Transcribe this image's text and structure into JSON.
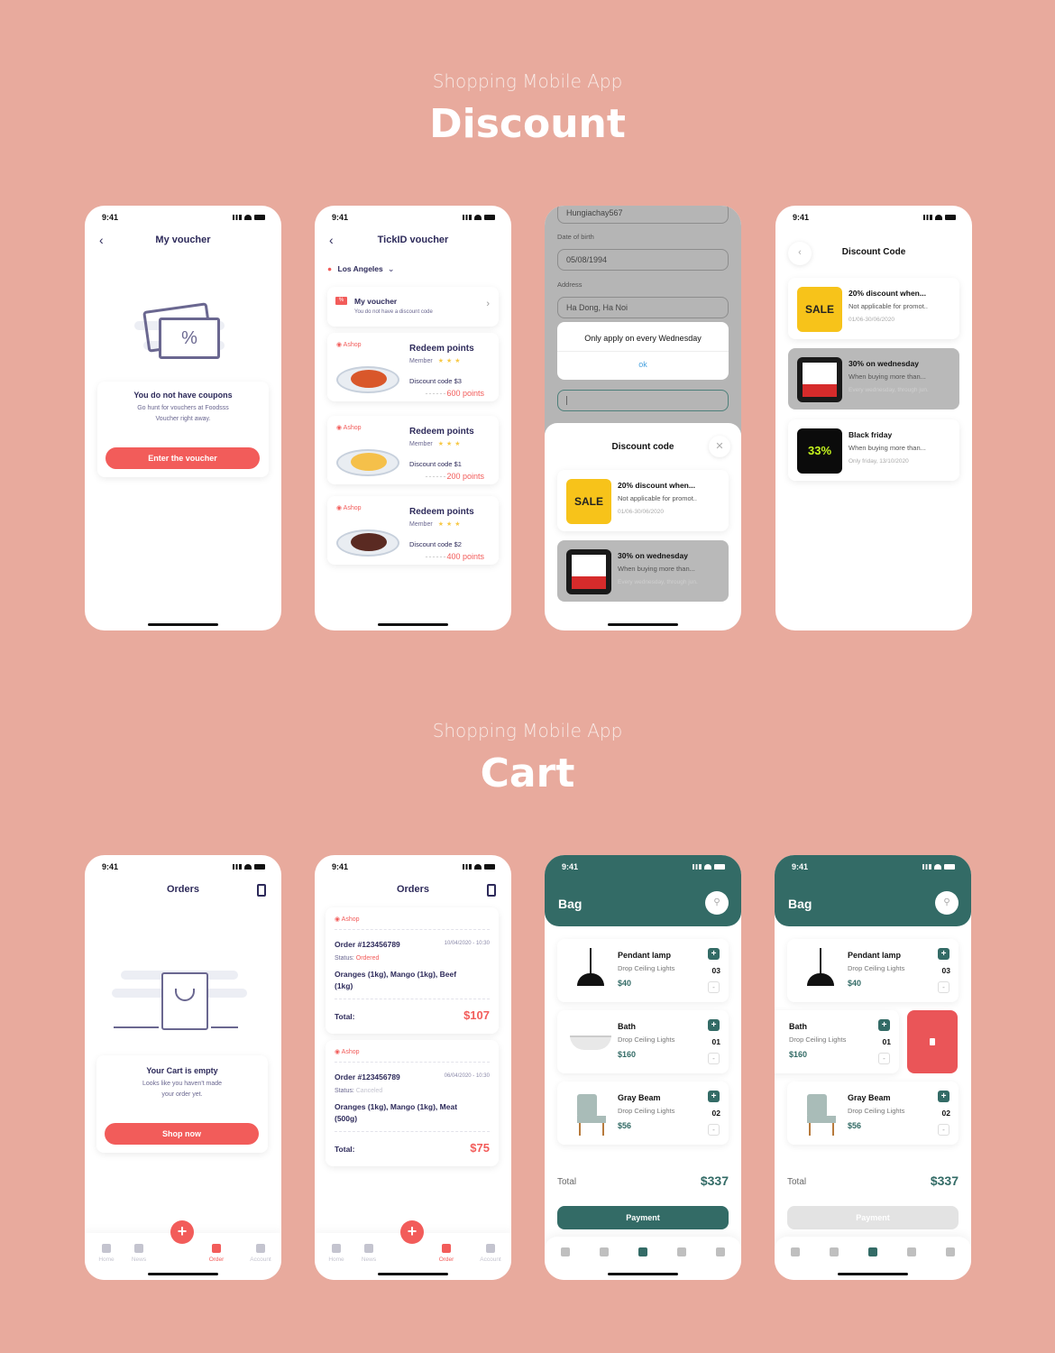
{
  "sections": [
    {
      "subtitle": "Shopping Mobile App",
      "title": "Discount"
    },
    {
      "subtitle": "Shopping Mobile App",
      "title": "Cart"
    }
  ],
  "status_time": "9:41",
  "my_voucher": {
    "title": "My voucher",
    "empty_title": "You do not have coupons",
    "empty_sub_1": "Go hunt for vouchers at Foodsss",
    "empty_sub_2": "Voucher right away.",
    "button": "Enter the voucher",
    "illustration_symbol": "%"
  },
  "tickid": {
    "title": "TickID voucher",
    "location": "Los Angeles",
    "my_voucher_label": "My voucher",
    "my_voucher_sub": "You do not have a discount code",
    "offers": [
      {
        "shop": "Ashop",
        "title": "Redeem points",
        "member": "Member",
        "stars": 3,
        "code": "Discount code $3",
        "points": "600 points",
        "food_color": "#d9572a"
      },
      {
        "shop": "Ashop",
        "title": "Redeem points",
        "member": "Member",
        "stars": 3,
        "code": "Discount code $1",
        "points": "200 points",
        "food_color": "#f5c04a"
      },
      {
        "shop": "Ashop",
        "title": "Redeem points",
        "member": "Member",
        "stars": 3,
        "code": "Discount code $2",
        "points": "400 points",
        "food_color": "#5a2a22"
      }
    ]
  },
  "profile_dialog": {
    "username_value": "Hungiachay567",
    "dob_label": "Date of birth",
    "dob_value": "05/08/1994",
    "address_label": "Address",
    "address_value": "Ha Dong, Ha Noi",
    "alert_message": "Only apply on every Wednesday",
    "alert_ok": "ok",
    "sheet_title": "Discount code"
  },
  "discount_codes": [
    {
      "title": "20% discount when...",
      "sub": "Not applicable for promot..",
      "date": "01/06-30/06/2020",
      "thumb_text": "SALE",
      "thumb_color": "#f7c31a",
      "selected": false
    },
    {
      "title": "30% on wednesday",
      "sub": "When buying more than...",
      "date": "Every wednesday, through jun.",
      "thumb_text": "",
      "thumb_color": "#1a1a1a",
      "selected": true
    },
    {
      "title": "Black friday",
      "sub": "When buying more than...",
      "date": "Only friday, 13/10/2020",
      "thumb_text": "33%",
      "thumb_color": "#0b0b0b",
      "selected": false
    }
  ],
  "discount_code_screen": {
    "title": "Discount Code"
  },
  "orders_empty": {
    "title": "Orders",
    "empty_title": "Your Cart is empty",
    "empty_sub_1": "Looks like you haven't made",
    "empty_sub_2": "your order yet.",
    "button": "Shop now"
  },
  "orders": {
    "title": "Orders",
    "list": [
      {
        "shop": "Ashop",
        "order_no": "Order #123456789",
        "datetime": "10/04/2020 - 10:30",
        "status_label": "Status:",
        "status": "Ordered",
        "status_color": "#f25c5a",
        "items_1": "Oranges (1kg), Mango (1kg), Beef",
        "items_2": "(1kg)",
        "total_label": "Total:",
        "total": "$107"
      },
      {
        "shop": "Ashop",
        "order_no": "Order #123456789",
        "datetime": "06/04/2020 - 10:30",
        "status_label": "Status:",
        "status": "Canceled",
        "status_color": "#c4c4cf",
        "items_1": "Oranges (1kg), Mango (1kg), Meat",
        "items_2": "(500g)",
        "total_label": "Total:",
        "total": "$75"
      }
    ]
  },
  "tabbar": {
    "items": [
      {
        "label": "Home",
        "icon": "home-icon"
      },
      {
        "label": "News",
        "icon": "bell-icon"
      },
      {
        "label": "Order",
        "icon": "bag-icon",
        "active": true
      },
      {
        "label": "Account",
        "icon": "user-icon"
      }
    ],
    "fab": "+"
  },
  "bag": {
    "title": "Bag",
    "items": [
      {
        "name": "Pendant lamp",
        "sub": "Drop Ceiling Lights",
        "price": "$40",
        "qty": "03"
      },
      {
        "name": "Bath",
        "sub": "Drop Ceiling Lights",
        "price": "$160",
        "qty": "01"
      },
      {
        "name": "Gray Beam",
        "sub": "Drop Ceiling Lights",
        "price": "$56",
        "qty": "02"
      }
    ],
    "total_label": "Total",
    "total": "$337",
    "payment": "Payment",
    "plus": "+",
    "minus": "-"
  },
  "colors": {
    "accent_red": "#f25c5a",
    "accent_teal": "#336b66",
    "background": "#e8aa9d",
    "text_dark": "#2d2a5a"
  }
}
